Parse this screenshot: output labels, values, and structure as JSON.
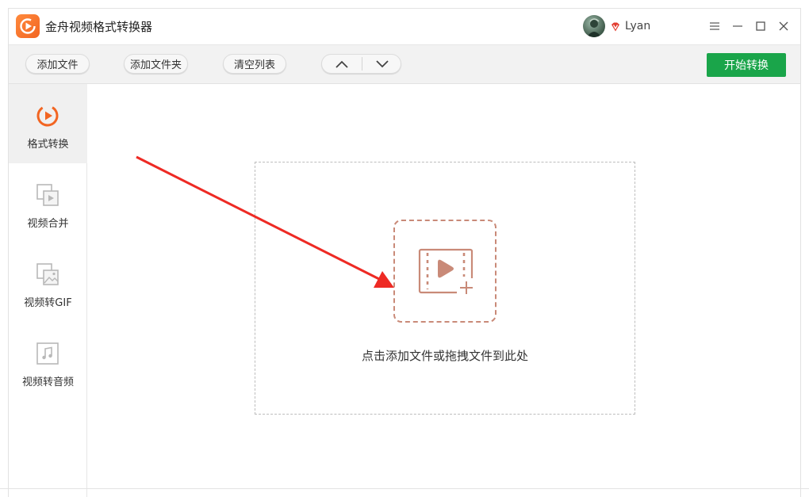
{
  "app": {
    "title": "金舟视频格式转换器",
    "logo_icon": "play-refresh-icon"
  },
  "user": {
    "name": "Lyan",
    "badge_icon": "vip-diamond-icon"
  },
  "window_controls": {
    "menu_icon": "menu-icon",
    "minimize_icon": "minimize-icon",
    "maximize_icon": "maximize-icon",
    "close_icon": "close-icon"
  },
  "toolbar": {
    "add_file": "添加文件",
    "add_folder": "添加文件夹",
    "clear_list": "清空列表",
    "move_up_icon": "chevron-up-icon",
    "move_down_icon": "chevron-down-icon",
    "start": "开始转换"
  },
  "sidebar": {
    "items": [
      {
        "label": "格式转换",
        "icon": "format-convert-icon",
        "active": true
      },
      {
        "label": "视频合并",
        "icon": "video-merge-icon",
        "active": false
      },
      {
        "label": "视频转GIF",
        "icon": "video-to-gif-icon",
        "active": false
      },
      {
        "label": "视频转音频",
        "icon": "video-to-audio-icon",
        "active": false
      }
    ]
  },
  "main": {
    "drop_text": "点击添加文件或拖拽文件到此处",
    "add_icon": "add-video-icon"
  },
  "colors": {
    "accent_orange": "#f26522",
    "start_green": "#1aa54a",
    "add_icon_color": "#c98a78",
    "arrow_red": "#ee2a24"
  }
}
